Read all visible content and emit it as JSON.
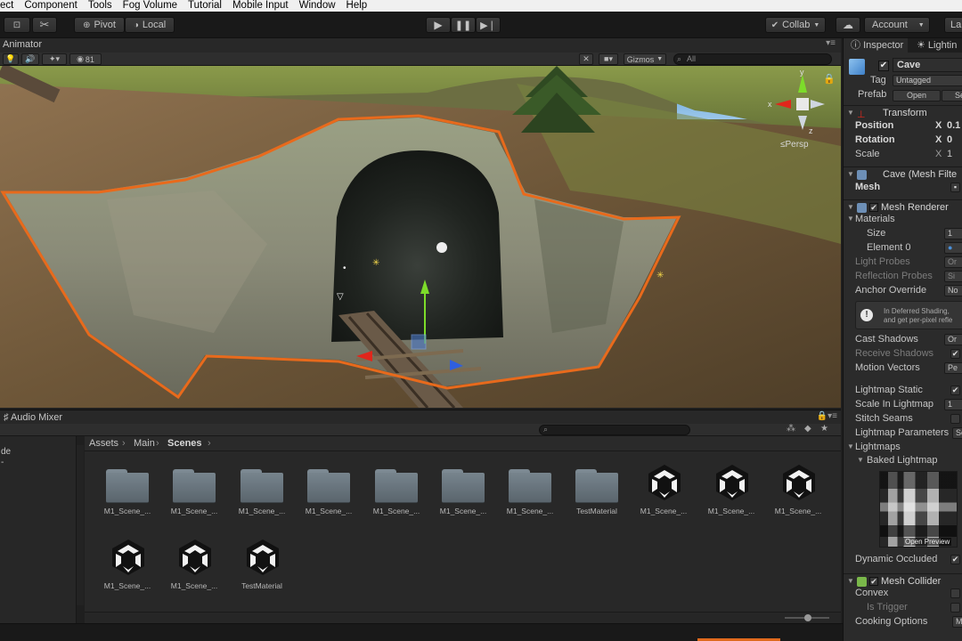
{
  "menubar": {
    "items": [
      "ect",
      "Component",
      "Tools",
      "Fog Volume",
      "Tutorial",
      "Mobile Input",
      "Window",
      "Help"
    ]
  },
  "toolbar": {
    "pivot_label": "Pivot",
    "local_label": "Local",
    "collab_label": "Collab",
    "account_label": "Account",
    "layers_label": "La"
  },
  "scene": {
    "tab_label": "Animator",
    "effects_count": "81",
    "gizmos_label": "Gizmos",
    "search_placeholder": "All",
    "persp_label": "Persp",
    "axis_y": "y",
    "axis_x": "x",
    "axis_z": "z"
  },
  "inspector": {
    "tabs": [
      "Inspector",
      "Lightin"
    ],
    "object_name": "Cave",
    "tag_label": "Tag",
    "tag_value": "Untagged",
    "prefab_label": "Prefab",
    "prefab_open": "Open",
    "prefab_select": "Se",
    "transform": {
      "title": "Transform",
      "position_label": "Position",
      "position_axis": "X",
      "position_x": "0.1",
      "rotation_label": "Rotation",
      "rotation_axis": "X",
      "rotation_x": "0",
      "scale_label": "Scale",
      "scale_axis": "X",
      "scale_x": "1"
    },
    "mesh_filter": {
      "title": "Cave (Mesh Filte",
      "mesh_label": "Mesh"
    },
    "mesh_renderer": {
      "title": "Mesh Renderer",
      "materials_label": "Materials",
      "size_label": "Size",
      "size_value": "1",
      "element0_label": "Element 0",
      "light_probes_label": "Light Probes",
      "light_probes_value": "Or",
      "reflection_probes_label": "Reflection Probes",
      "reflection_probes_value": "Si",
      "anchor_override_label": "Anchor Override",
      "anchor_override_value": "No",
      "info_line1": "In Deferred Shading,",
      "info_line2": "and get per-pixel refle",
      "cast_shadows_label": "Cast Shadows",
      "cast_shadows_value": "Or",
      "receive_shadows_label": "Receive Shadows",
      "motion_vectors_label": "Motion Vectors",
      "motion_vectors_value": "Pe",
      "lightmap_static_label": "Lightmap Static",
      "scale_in_lightmap_label": "Scale In Lightmap",
      "scale_in_lightmap_value": "1",
      "stitch_seams_label": "Stitch Seams",
      "lightmap_parameters_label": "Lightmap Parameters",
      "lightmap_parameters_value": "Se",
      "lightmaps_label": "Lightmaps",
      "baked_lightmap_label": "Baked Lightmap",
      "open_preview_label": "Open Preview",
      "dynamic_occluded_label": "Dynamic Occluded"
    },
    "mesh_collider": {
      "title": "Mesh Collider",
      "convex_label": "Convex",
      "is_trigger_label": "Is Trigger",
      "cooking_options_label": "Cooking Options",
      "cooking_options_value": "M"
    }
  },
  "bottom": {
    "tab_label": "Audio Mixer",
    "left_lines": [
      "de",
      "-"
    ]
  },
  "project": {
    "breadcrumb": [
      "Assets",
      "Main",
      "Scenes"
    ],
    "assets": [
      {
        "label": "M1_Scene_...",
        "kind": "folder"
      },
      {
        "label": "M1_Scene_...",
        "kind": "folder"
      },
      {
        "label": "M1_Scene_...",
        "kind": "folder"
      },
      {
        "label": "M1_Scene_...",
        "kind": "folder"
      },
      {
        "label": "M1_Scene_...",
        "kind": "folder"
      },
      {
        "label": "M1_Scene_...",
        "kind": "folder"
      },
      {
        "label": "M1_Scene_...",
        "kind": "folder"
      },
      {
        "label": "TestMaterial",
        "kind": "folder"
      },
      {
        "label": "M1_Scene_...",
        "kind": "unity-scene"
      },
      {
        "label": "M1_Scene_...",
        "kind": "unity-scene"
      },
      {
        "label": "M1_Scene_...",
        "kind": "unity-scene"
      },
      {
        "label": "M1_Scene_...",
        "kind": "unity-scene"
      },
      {
        "label": "M1_Scene_...",
        "kind": "unity-scene"
      },
      {
        "label": "TestMaterial",
        "kind": "unity-scene"
      }
    ]
  },
  "colors": {
    "selection_outline": "#e86a1c",
    "gizmo_y": "#7ddc2a",
    "gizmo_x": "#e0261b",
    "gizmo_z": "#2f5fe0"
  }
}
